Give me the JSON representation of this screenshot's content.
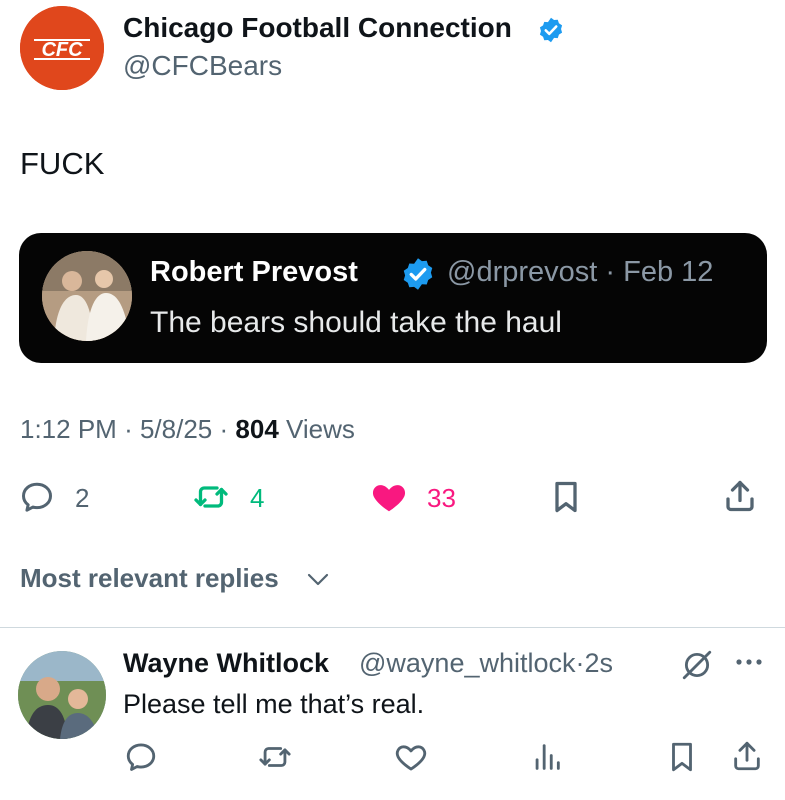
{
  "author": {
    "avatar_text": "CFC",
    "name": "Chicago Football Connection",
    "handle": "@CFCBears"
  },
  "tweet": {
    "text": "FUCK"
  },
  "quote": {
    "name": "Robert Prevost",
    "handle": "@drprevost",
    "separator": "·",
    "date": "Feb 12",
    "text": "The bears should take the haul"
  },
  "meta": {
    "time": "1:12 PM",
    "sep1": "·",
    "date": "5/8/25",
    "sep2": "·",
    "views_count": "804",
    "views_label": "Views"
  },
  "actions": {
    "replies": "2",
    "reposts": "4",
    "likes": "33"
  },
  "replies_filter": {
    "label": "Most relevant replies"
  },
  "reply": {
    "name": "Wayne Whitlock",
    "handle": "@wayne_whitlock",
    "separator": "·",
    "time": "2s",
    "text": "Please tell me that’s real."
  },
  "colors": {
    "accent_blue": "#1d9bf0",
    "repost_green": "#00ba7c",
    "like_pink": "#f91880",
    "secondary_text": "#536471",
    "cfc_orange": "#e0471c"
  }
}
